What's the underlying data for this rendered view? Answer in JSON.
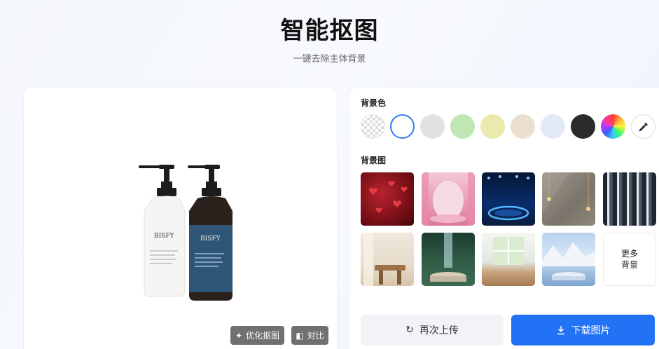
{
  "header": {
    "title": "智能抠图",
    "subtitle": "一键去除主体背景"
  },
  "preview": {
    "product_label_1": "BISFY",
    "product_label_2": "BISFY",
    "optimize_label": "优化抠图",
    "compare_label": "对比"
  },
  "settings": {
    "bg_color_label": "背景色",
    "bg_image_label": "背景图",
    "colors": [
      {
        "name": "transparent",
        "value": "transparent"
      },
      {
        "name": "white",
        "value": "#ffffff"
      },
      {
        "name": "light-gray",
        "value": "#e2e2e2"
      },
      {
        "name": "light-green",
        "value": "#bfe6b3"
      },
      {
        "name": "light-yellow",
        "value": "#ece9ad"
      },
      {
        "name": "beige",
        "value": "#ebdfcf"
      },
      {
        "name": "light-blue",
        "value": "#e3e9f6"
      },
      {
        "name": "black",
        "value": "#2b2b2b"
      },
      {
        "name": "rainbow",
        "value": "custom"
      }
    ],
    "picker_icon": "eyedropper-icon",
    "more_bg_label_1": "更多",
    "more_bg_label_2": "背景",
    "backgrounds": [
      "red-hearts",
      "pink-arch",
      "blue-neon-stage",
      "taupe-wall-lamps",
      "dark-stripes",
      "window-wood-stool",
      "forest-waterfall-podium",
      "window-wood-table",
      "snow-mountain-lake-podium"
    ]
  },
  "actions": {
    "reupload_label": "再次上传",
    "download_label": "下载图片",
    "accent": "#2272f6"
  }
}
